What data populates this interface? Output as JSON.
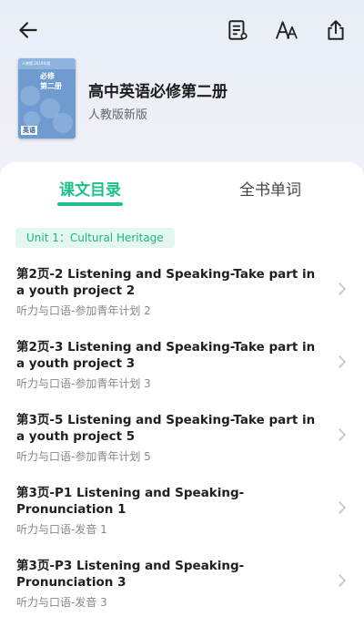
{
  "toolbar": {
    "back_icon": "arrow-left-icon",
    "notes_icon": "notes-icon",
    "font_icon": "font-size-icon",
    "share_icon": "share-icon"
  },
  "book": {
    "title": "高中英语必修第二册",
    "publisher": "人教版新版",
    "cover": {
      "band_text": "人教版 2019年版",
      "title_line1": "必修",
      "title_line2": "第二册",
      "tag": "英语",
      "color": "#6f9bd1"
    }
  },
  "tabs": [
    {
      "label": "课文目录",
      "active": true
    },
    {
      "label": "全书单词",
      "active": false
    }
  ],
  "unit": {
    "label": "Unit 1：Cultural Heritage"
  },
  "lessons": [
    {
      "title": "第2页-2 Listening and Speaking-Take part in a youth project 2",
      "subtitle": "听力与口语-参加青年计划 2"
    },
    {
      "title": "第2页-3 Listening and Speaking-Take part in a youth project 3",
      "subtitle": "听力与口语-参加青年计划 3"
    },
    {
      "title": "第3页-5 Listening and Speaking-Take part in a youth project 5",
      "subtitle": "听力与口语-参加青年计划 5"
    },
    {
      "title": "第3页-P1 Listening and Speaking-Pronunciation 1",
      "subtitle": "听力与口语-发音 1"
    },
    {
      "title": "第3页-P3 Listening and Speaking-Pronunciation 3",
      "subtitle": "听力与口语-发音 3"
    }
  ],
  "colors": {
    "accent": "#1fc08e",
    "chip_bg": "#e3f7ef",
    "text_primary": "#202020",
    "text_secondary": "#888888"
  }
}
